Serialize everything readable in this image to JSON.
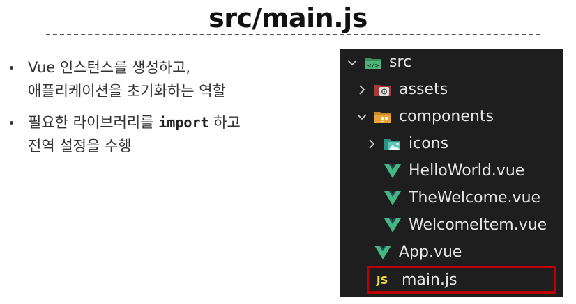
{
  "title": "src/main.js",
  "bullets": [
    {
      "line1": "Vue 인스턴스를 생성하고,",
      "line2": "애플리케이션을 초기화하는 역할"
    },
    {
      "line1_before": "필요한 라이브러리를 ",
      "line1_code": "import",
      "line1_after": " 하고",
      "line2": "전역 설정을 수행"
    }
  ],
  "explorer": {
    "items": [
      {
        "label": "src",
        "icon": "src-folder-icon",
        "expanded": true
      },
      {
        "label": "assets",
        "icon": "assets-folder-icon",
        "expanded": false
      },
      {
        "label": "components",
        "icon": "components-folder-icon",
        "expanded": true
      },
      {
        "label": "icons",
        "icon": "image-folder-icon",
        "expanded": false
      },
      {
        "label": "HelloWorld.vue",
        "icon": "vue-icon"
      },
      {
        "label": "TheWelcome.vue",
        "icon": "vue-icon"
      },
      {
        "label": "WelcomeItem.vue",
        "icon": "vue-icon"
      },
      {
        "label": "App.vue",
        "icon": "vue-icon"
      },
      {
        "label": "main.js",
        "icon": "js-icon",
        "icon_text": "JS",
        "selected": true
      }
    ]
  },
  "colors": {
    "explorer_bg": "#1e1e1e",
    "selection_border": "#c00000",
    "vue_green": "#41b883",
    "js_yellow": "#f1dd35",
    "folder_yellow": "#e8a43a"
  }
}
